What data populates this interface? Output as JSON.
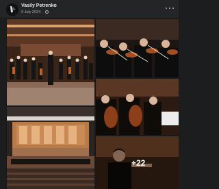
{
  "post": {
    "author": "Vasily Petrenko",
    "date": "9 July 2024",
    "separator": "·",
    "avatar_icon": "author-avatar",
    "more_icon": "more-options-icon",
    "privacy_icon": "globe-icon"
  },
  "gallery": {
    "photos": [
      {
        "name": "orchestra-stage-photo"
      },
      {
        "name": "violinists-photo"
      },
      {
        "name": "cellists-photo"
      },
      {
        "name": "concert-hall-photo"
      },
      {
        "name": "conductor-photo"
      }
    ],
    "more_count": "+22"
  },
  "colors": {
    "background": "#242526",
    "text": "#e4e6eb",
    "secondary_text": "#b0b3b8",
    "stage_warm": "#b8713f"
  }
}
